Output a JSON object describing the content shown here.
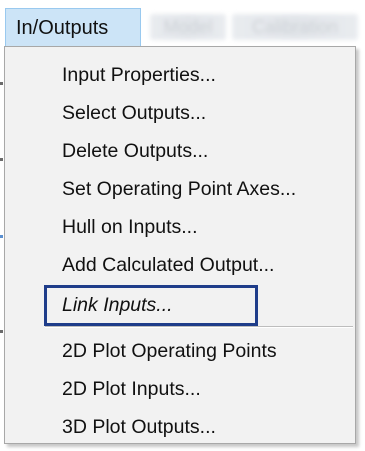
{
  "menubar": {
    "active_menu": "In/Outputs",
    "other_menus": [
      "Model",
      "Calibration"
    ]
  },
  "dropdown": {
    "items": [
      {
        "label": "Input Properties..."
      },
      {
        "label": "Select Outputs..."
      },
      {
        "label": "Delete Outputs..."
      },
      {
        "label": "Set Operating Point Axes..."
      },
      {
        "label": "Hull on Inputs..."
      },
      {
        "label": "Add Calculated Output..."
      },
      {
        "label": "Link Inputs..."
      },
      {
        "label": "2D Plot Operating Points"
      },
      {
        "label": "2D Plot Inputs..."
      },
      {
        "label": "3D Plot Outputs..."
      }
    ],
    "focused_item": "Link Inputs...",
    "focus_color": "#1f3d8a",
    "highlight_color": "#cce4f7"
  }
}
